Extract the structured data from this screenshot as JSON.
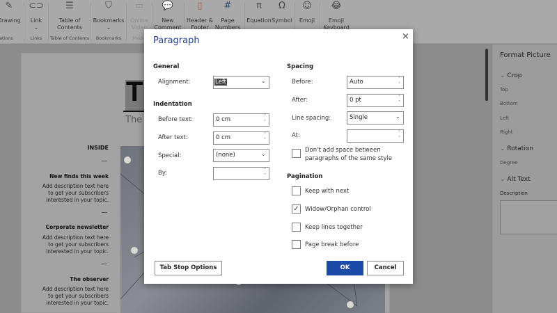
{
  "ribbon": {
    "buttons": [
      {
        "label": "Drawing",
        "icon": "drawing-icon"
      },
      {
        "label": "Link",
        "icon": "link-icon"
      },
      {
        "label": "Table of Contents",
        "icon": "toc-icon"
      },
      {
        "label": "Bookmarks",
        "icon": "bookmark-icon"
      },
      {
        "label": "Online Video",
        "icon": "video-icon"
      },
      {
        "label": "New Comment",
        "icon": "comment-icon"
      },
      {
        "label": "Header & Footer",
        "icon": "header-footer-icon"
      },
      {
        "label": "Page Numbers",
        "icon": "page-number-icon"
      },
      {
        "label": "Equation",
        "icon": "pi-icon"
      },
      {
        "label": "Symbol",
        "icon": "omega-icon"
      },
      {
        "label": "Emoji",
        "icon": "smiley-icon"
      },
      {
        "label": "Emoji Keyboard",
        "icon": "emoji-icon"
      }
    ],
    "groups": [
      "ations",
      "Links",
      "Table of Contents",
      "Bookmarks",
      "Media"
    ]
  },
  "document": {
    "title": "Th",
    "subtitle": "The I",
    "inside": "INSIDE",
    "items": [
      {
        "heading": "New finds this week",
        "text": "Add description text here to get your subscribers interested in your topic."
      },
      {
        "heading": "Corporate newsletter",
        "text": "Add description text here to get your subscribers interested in your topic."
      },
      {
        "heading": "The observer",
        "text": "Add description text here to get your subscribers interested in your topic."
      }
    ]
  },
  "pane": {
    "title": "Format Picture",
    "crop": "Crop",
    "crop_fields": [
      "Top",
      "Bottom",
      "Left",
      "Right"
    ],
    "rotation": "Rotation",
    "degree": "Degree",
    "alt_text": "Alt Text",
    "description": "Description"
  },
  "dialog": {
    "title": "Paragraph",
    "close": "×",
    "general": "General",
    "alignment_label": "Alignment:",
    "alignment_value": "Left",
    "indentation": "Indentation",
    "before_text_label": "Before text:",
    "before_text_value": "0 cm",
    "after_text_label": "After text:",
    "after_text_value": "0 cm",
    "special_label": "Special:",
    "special_value": "(none)",
    "by_label": "By:",
    "by_value": "",
    "spacing": "Spacing",
    "before_label": "Before:",
    "before_value": "Auto",
    "after_label": "After:",
    "after_value": "0 pt",
    "line_spacing_label": "Line spacing:",
    "line_spacing_value": "Single",
    "at_label": "At:",
    "at_value": "",
    "dont_add_space": "Don't add space between paragraphs of the same style",
    "dont_add_space_checked": false,
    "pagination": "Pagination",
    "checks": [
      {
        "label": "Keep with next",
        "checked": false
      },
      {
        "label": "Widow/Orphan control",
        "checked": true
      },
      {
        "label": "Keep lines together",
        "checked": false
      },
      {
        "label": "Page break before",
        "checked": false
      }
    ],
    "tab_stop": "Tab Stop Options",
    "ok": "OK",
    "cancel": "Cancel",
    "accent": "#1c4aa8"
  }
}
